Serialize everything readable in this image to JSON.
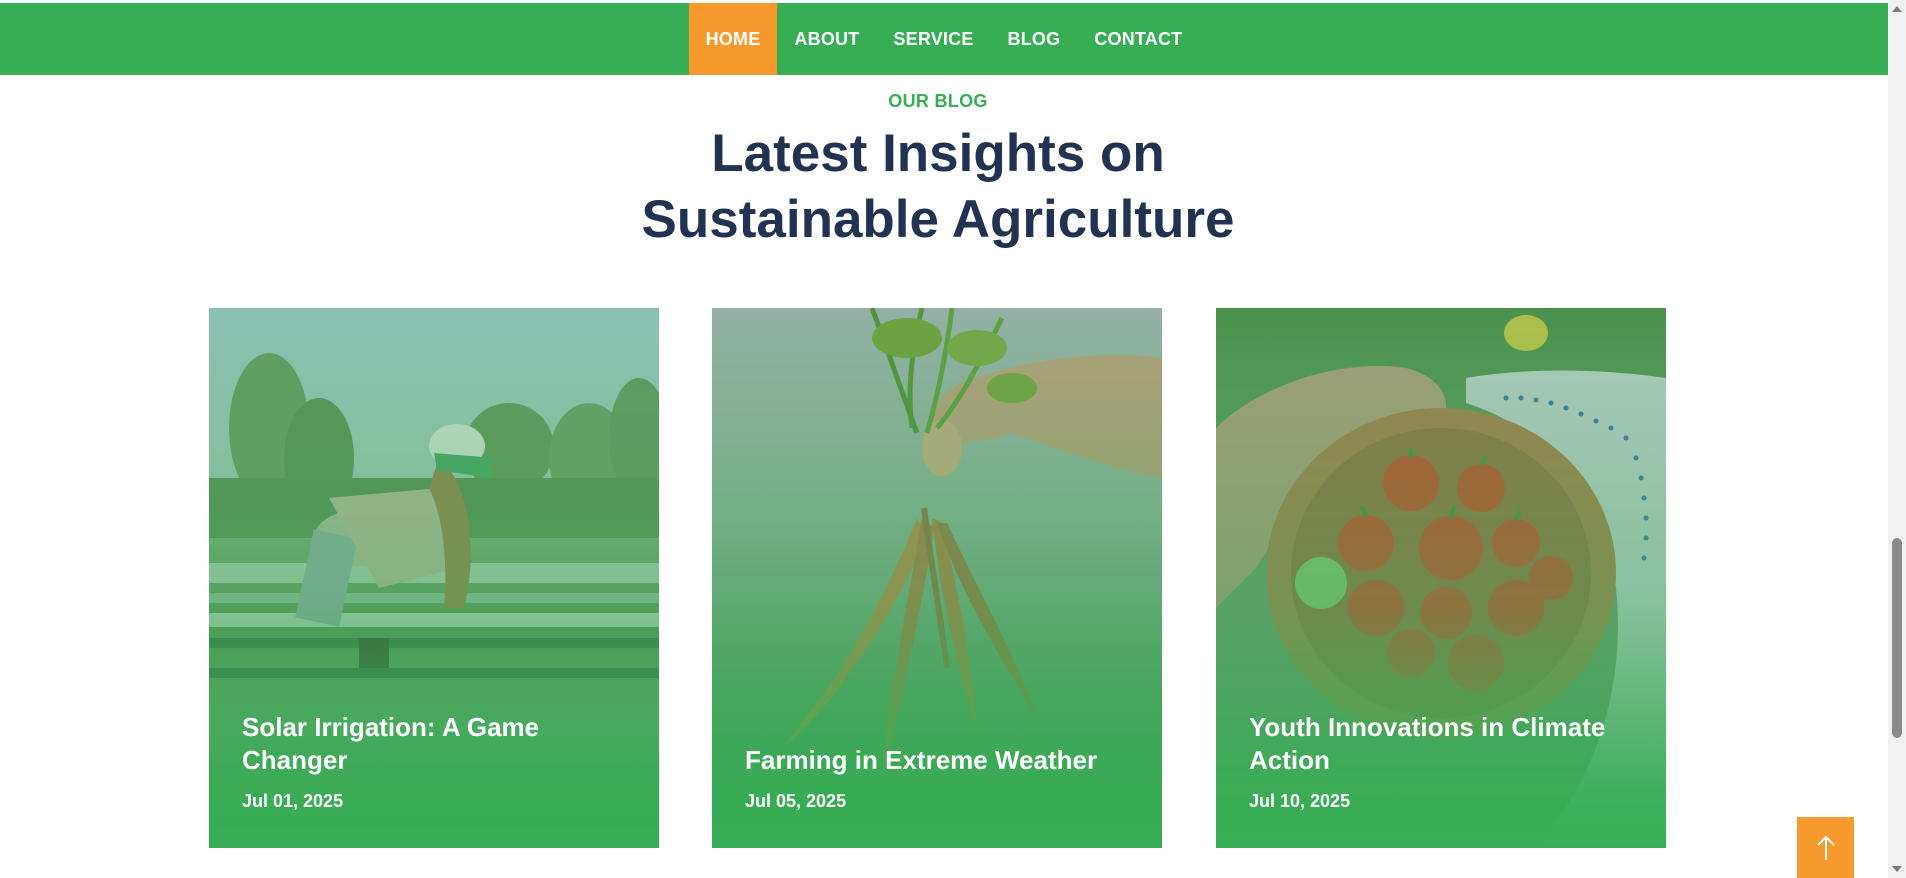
{
  "nav": {
    "items": [
      {
        "label": "HOME",
        "active": true
      },
      {
        "label": "ABOUT",
        "active": false
      },
      {
        "label": "SERVICE",
        "active": false
      },
      {
        "label": "BLOG",
        "active": false
      },
      {
        "label": "CONTACT",
        "active": false
      }
    ]
  },
  "section": {
    "kicker": "OUR BLOG",
    "title_line1": "Latest Insights on",
    "title_line2": "Sustainable Agriculture"
  },
  "posts": [
    {
      "title": "Solar Irrigation: A Game Changer",
      "date": "Jul 01, 2025"
    },
    {
      "title": "Farming in Extreme Weather",
      "date": "Jul 05, 2025"
    },
    {
      "title": "Youth Innovations in Climate Action",
      "date": "Jul 10, 2025"
    }
  ],
  "icons": {
    "back_to_top": "arrow-up-icon"
  },
  "colors": {
    "brand_green": "#37ae55",
    "accent_orange": "#f79a2e",
    "heading_navy": "#223352"
  }
}
